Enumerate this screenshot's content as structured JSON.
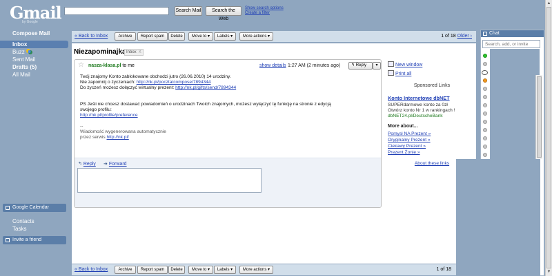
{
  "header": {
    "logo_text": "Gmail",
    "logo_sub": "by Google",
    "search_mail_label": "Search Mail",
    "search_web_label": "Search the Web",
    "show_search_options": "Show search options",
    "create_filter": "Create a filter"
  },
  "nav": {
    "compose": "Compose Mail",
    "items": [
      {
        "label": "Inbox"
      },
      {
        "label": "Buzz"
      },
      {
        "label": "Sent Mail"
      },
      {
        "label": "Drafts (5)"
      },
      {
        "label": "All Mail"
      }
    ],
    "google_calendar": "Google Calendar",
    "contacts": "Contacts",
    "tasks": "Tasks",
    "invite_friend": "Invite a friend"
  },
  "toolbar": {
    "back": "« Back to Inbox",
    "archive": "Archive",
    "report_spam": "Report spam",
    "delete": "Delete",
    "move_to": "Move to ▾",
    "labels": "Labels ▾",
    "more_actions": "More actions ▾",
    "pager_top": "1 of 18",
    "older": "Older ›",
    "pager_bottom": "1 of 18"
  },
  "message": {
    "subject": "Niezapominajka",
    "label": "Inbox",
    "label_remove": "X",
    "sender": "nasza-klasa.pl",
    "to": "to me",
    "show_details": "show details",
    "time": "1:27 AM (2 minutes ago)",
    "reply_button": "Reply",
    "reply_menu": "▾",
    "body": {
      "line1": "Twój znajomy  Konto zablokowane obchodzi jutro (26.06.2010) 14 urodziny.",
      "line2_text": "Nie zapomnij o życzeniach: ",
      "line2_link": "http://nk.pl/poczta/compose/7894344",
      "line3_text": "Do życzeń możesz dołączyć wirtualny prezent: ",
      "line3_link": "http://nk.pl/gifts/send/7894344",
      "ps_line1": "PS Jeśli nie chcesz dostawać powiadomień o urodzinach Twoich znajomych, możesz wyłączyć tę funkcję na stronie z edycją",
      "ps_line2": "swojego profilu:",
      "ps_link": "http://nk.pl/profile/preference",
      "sig_dash": "--",
      "sig_line1": "Wiadomość wygenerowana automatycznie",
      "sig_line2_text": "przez serwis ",
      "sig_link": "http://nk.pl/"
    },
    "reply_action": "Reply",
    "forward_action": "Forward"
  },
  "right_col": {
    "new_window": "New window",
    "print_all": "Print all",
    "sponsored": "Sponsored Links",
    "ad_title": "Konto Internetowe dbNET",
    "ad_line1": "SUPERdarmowe konto za 0zł",
    "ad_line2": "Otwórz konto Nr 1 w rankingach !",
    "ad_url": "dbNET24.pl/DeutscheBank",
    "more_about": "More about...",
    "more_links": [
      "Pomysł NA Prezent »",
      "Oryginalny Prezent »",
      "Ciekawy Prezent »",
      "Prezent Żonie »"
    ],
    "about_links": "About these links"
  },
  "chat": {
    "title": "Chat",
    "search_placeholder": "Search, add, or invite"
  }
}
